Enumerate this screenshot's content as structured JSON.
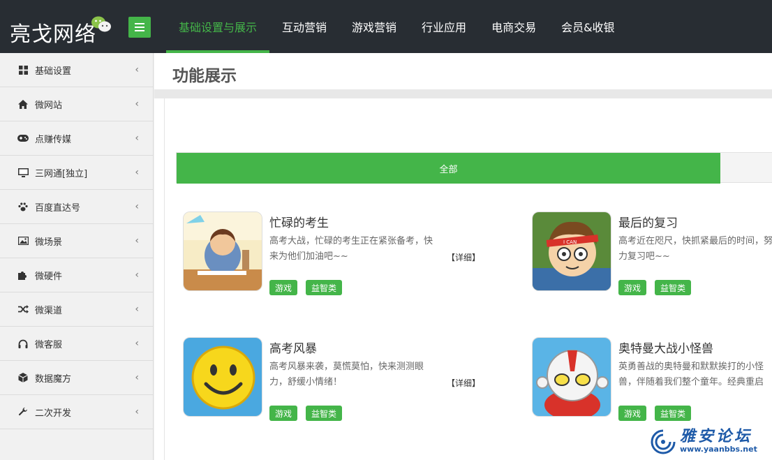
{
  "header": {
    "logo_text": "亮戈网络",
    "nav": [
      {
        "label": "基础设置与展示",
        "active": true
      },
      {
        "label": "互动营销"
      },
      {
        "label": "游戏营销"
      },
      {
        "label": "行业应用"
      },
      {
        "label": "电商交易"
      },
      {
        "label": "会员&收银"
      }
    ]
  },
  "sidebar": {
    "items": [
      {
        "label": "基础设置",
        "icon": "grid-icon"
      },
      {
        "label": "微网站",
        "icon": "home-icon"
      },
      {
        "label": "点赚传媒",
        "icon": "gamepad-icon"
      },
      {
        "label": "三网通[独立]",
        "icon": "monitor-icon"
      },
      {
        "label": "百度直达号",
        "icon": "paw-icon"
      },
      {
        "label": "微场景",
        "icon": "image-icon"
      },
      {
        "label": "微硬件",
        "icon": "puzzle-icon"
      },
      {
        "label": "微渠道",
        "icon": "shuffle-icon"
      },
      {
        "label": "微客服",
        "icon": "headphones-icon"
      },
      {
        "label": "数据魔方",
        "icon": "cube-icon"
      },
      {
        "label": "二次开发",
        "icon": "wrench-icon"
      }
    ]
  },
  "main": {
    "title": "功能展示",
    "tab_all": "全部",
    "cards": [
      {
        "title": "忙碌的考生",
        "desc": "高考大战，忙碌的考生正在紧张备考，快来为他们加油吧~~",
        "detail": "【详细】",
        "tags": [
          "游戏",
          "益智类"
        ]
      },
      {
        "title": "最后的复习",
        "desc": "高考近在咫尺，快抓紧最后的时间，努力复习吧~~",
        "detail": "",
        "tags": [
          "游戏",
          "益智类"
        ]
      },
      {
        "title": "高考风暴",
        "desc": "高考风暴来袭，莫慌莫怕，快来测测眼力，舒缓小情绪！",
        "detail": "【详细】",
        "tags": [
          "游戏",
          "益智类"
        ]
      },
      {
        "title": "奥特曼大战小怪兽",
        "desc": "英勇善战的奥特曼和默默挨打的小怪兽，伴随着我们整个童年。经典重启",
        "detail": "",
        "tags": [
          "游戏",
          "益智类"
        ]
      }
    ]
  },
  "watermark": {
    "text": "雅安论坛",
    "url": "www.yaanbbs.net"
  },
  "colors": {
    "accent": "#44b549",
    "topbar": "#282d33"
  }
}
